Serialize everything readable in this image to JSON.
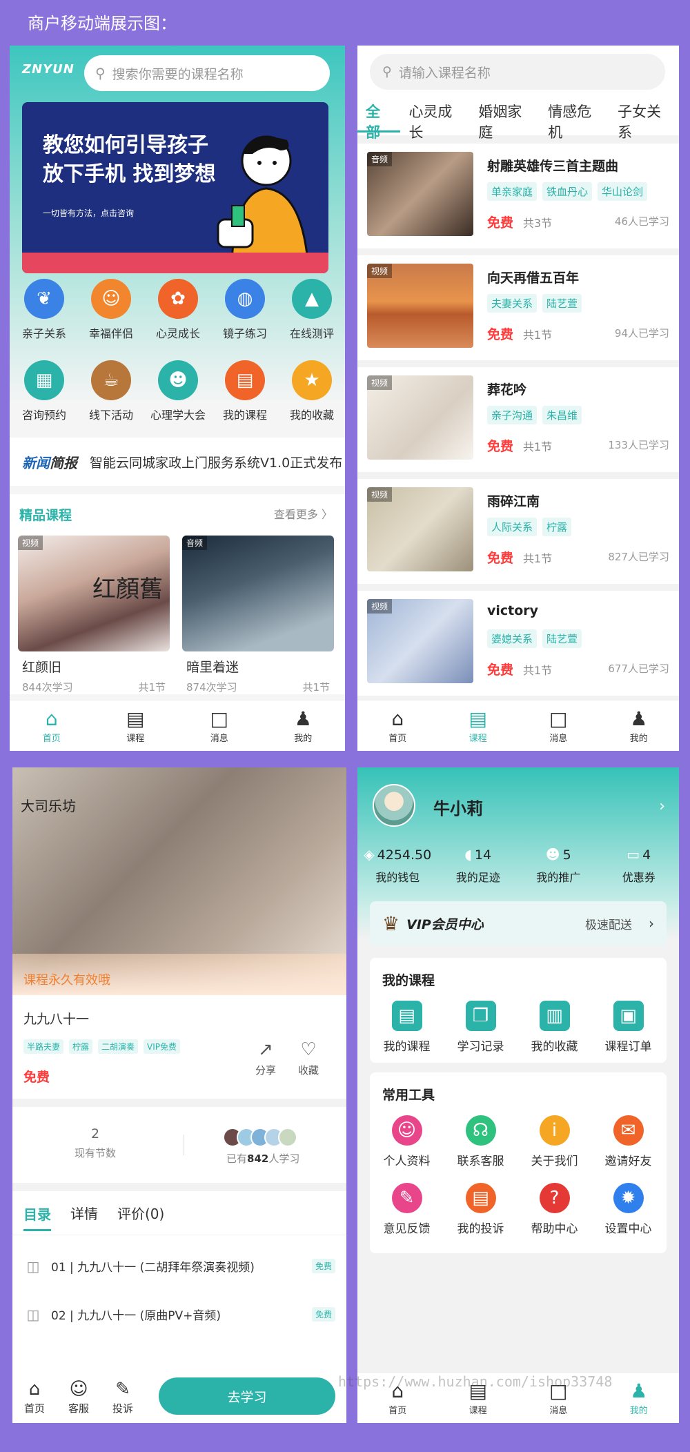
{
  "caption": "商户移动端展示图：",
  "p1": {
    "logo": "ZNYUN",
    "search_placeholder": "搜索你需要的课程名称",
    "banner": {
      "line1": "教您如何引导孩子",
      "line2": "放下手机 找到梦想",
      "sub": "一切皆有方法，点击咨询"
    },
    "categories": [
      {
        "label": "亲子关系",
        "icon": "leaf-icon",
        "color": "#3b82e6"
      },
      {
        "label": "幸福伴侣",
        "icon": "family-icon",
        "color": "#f2862e"
      },
      {
        "label": "心灵成长",
        "icon": "palette-icon",
        "color": "#f0642a"
      },
      {
        "label": "镜子练习",
        "icon": "globe-icon",
        "color": "#3b82e6"
      },
      {
        "label": "在线测评",
        "icon": "graduation-icon",
        "color": "#2bb3aa"
      },
      {
        "label": "咨询预约",
        "icon": "calendar-icon",
        "color": "#2bb3aa"
      },
      {
        "label": "线下活动",
        "icon": "cup-icon",
        "color": "#b8773a"
      },
      {
        "label": "心理学大会",
        "icon": "people-icon",
        "color": "#2bb3aa"
      },
      {
        "label": "我的课程",
        "icon": "book-icon",
        "color": "#f0642a"
      },
      {
        "label": "我的收藏",
        "icon": "star-icon",
        "color": "#f5a623"
      }
    ],
    "news_tag_a": "新闻",
    "news_tag_b": "简报",
    "news_text": "智能云同城家政上门服务系统V1.0正式发布",
    "section_title": "精品课程",
    "section_more": "查看更多 〉",
    "cards": [
      {
        "badge": "视频",
        "name": "红颜旧",
        "learn": "844次学习",
        "sections": "共1节"
      },
      {
        "badge": "音频",
        "name": "暗里着迷",
        "learn": "874次学习",
        "sections": "共1节"
      }
    ],
    "tabs": [
      "首页",
      "课程",
      "消息",
      "我的"
    ]
  },
  "p2": {
    "search_placeholder": "请输入课程名称",
    "cat_tabs": [
      "全部",
      "心灵成长",
      "婚姻家庭",
      "情感危机",
      "子女关系"
    ],
    "courses": [
      {
        "badge": "音频",
        "name": "射雕英雄传三首主题曲",
        "tags": [
          "单亲家庭",
          "铁血丹心",
          "华山论剑"
        ],
        "free": "免费",
        "sections": "共3节",
        "learn": "46人已学习"
      },
      {
        "badge": "视频",
        "name": "向天再借五百年",
        "tags": [
          "夫妻关系",
          "陆艺萱"
        ],
        "free": "免费",
        "sections": "共1节",
        "learn": "94人已学习"
      },
      {
        "badge": "视频",
        "name": "葬花吟",
        "tags": [
          "亲子沟通",
          "朱昌维"
        ],
        "free": "免费",
        "sections": "共1节",
        "learn": "133人已学习"
      },
      {
        "badge": "视频",
        "name": "雨碎江南",
        "tags": [
          "人际关系",
          "柠露"
        ],
        "free": "免费",
        "sections": "共1节",
        "learn": "827人已学习"
      },
      {
        "badge": "视频",
        "name": "victory",
        "tags": [
          "婆媳关系",
          "陆艺萱"
        ],
        "free": "免费",
        "sections": "共1节",
        "learn": "677人已学习"
      }
    ],
    "tabs": [
      "首页",
      "课程",
      "消息",
      "我的"
    ]
  },
  "p3": {
    "brand": "大司乐坊",
    "valid": "课程永久有效哦",
    "name": "九九八十一",
    "tags": [
      "半路夫妻",
      "柠露",
      "二胡演奏",
      "VIP免费"
    ],
    "free": "免费",
    "share": "分享",
    "collect": "收藏",
    "count": "2",
    "count_label": "现有节数",
    "learn_pre": "已有",
    "learn_num": "842",
    "learn_post": "人学习",
    "toc_tabs": [
      "目录",
      "详情",
      "评价(0)"
    ],
    "lessons": [
      {
        "title": "01 | 九九八十一 (二胡拜年祭演奏视频)",
        "tag": "免费"
      },
      {
        "title": "02 | 九九八十一 (原曲PV+音频)",
        "tag": "免费"
      }
    ],
    "bottom": [
      "首页",
      "客服",
      "投诉"
    ],
    "go": "去学习"
  },
  "p4": {
    "username": "牛小莉",
    "stats": [
      {
        "value": "4254.50",
        "label": "我的钱包",
        "icon": "wallet-icon"
      },
      {
        "value": "14",
        "label": "我的足迹",
        "icon": "footprint-icon"
      },
      {
        "value": "5",
        "label": "我的推广",
        "icon": "group-icon"
      },
      {
        "value": "4",
        "label": "优惠券",
        "icon": "coupon-icon"
      }
    ],
    "vip_title": "VIP会员中心",
    "vip_sub": "极速配送",
    "my_courses_title": "我的课程",
    "my_courses": [
      {
        "label": "我的课程",
        "icon": "book-icon"
      },
      {
        "label": "学习记录",
        "icon": "open-book-icon"
      },
      {
        "label": "我的收藏",
        "icon": "bookmark-icon"
      },
      {
        "label": "课程订单",
        "icon": "clipboard-icon"
      }
    ],
    "tools_title": "常用工具",
    "tools": [
      {
        "label": "个人资料",
        "icon": "profile-icon",
        "color": "#e8458b"
      },
      {
        "label": "联系客服",
        "icon": "headset-icon",
        "color": "#2ec27e"
      },
      {
        "label": "关于我们",
        "icon": "info-icon",
        "color": "#f5a623"
      },
      {
        "label": "邀请好友",
        "icon": "mail-icon",
        "color": "#f0642a"
      },
      {
        "label": "意见反馈",
        "icon": "feedback-icon",
        "color": "#e8458b"
      },
      {
        "label": "我的投诉",
        "icon": "document-icon",
        "color": "#f0642a"
      },
      {
        "label": "帮助中心",
        "icon": "help-icon",
        "color": "#e53935"
      },
      {
        "label": "设置中心",
        "icon": "gear-icon",
        "color": "#2f80ed"
      }
    ],
    "tabs": [
      "首页",
      "课程",
      "消息",
      "我的"
    ]
  },
  "watermark": "https://www.huzhan.com/ishop33748"
}
